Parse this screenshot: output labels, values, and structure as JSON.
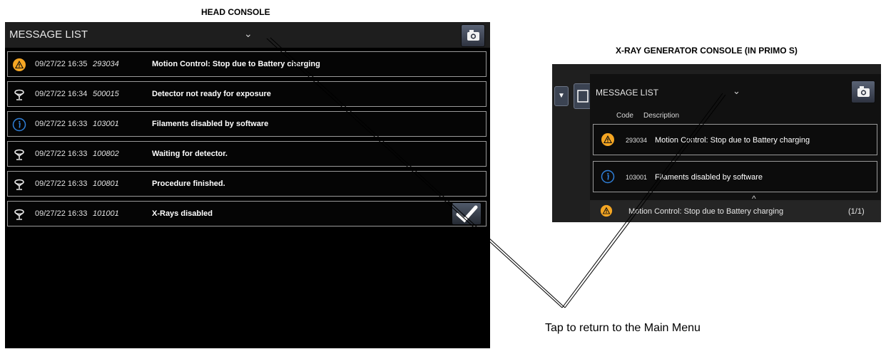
{
  "captions": {
    "head_console": "HEAD CONSOLE",
    "xray_console": "X-RAY GENERATOR CONSOLE (IN PRIMO S)",
    "tap_note": "Tap to return to the Main Menu"
  },
  "head_console": {
    "title": "MESSAGE LIST",
    "chevron": "⌄",
    "messages": [
      {
        "icon": "warning-icon",
        "datetime": "09/27/22 16:35",
        "code": "293034",
        "description": "Motion Control: Stop due to Battery charging"
      },
      {
        "icon": "detector-icon",
        "datetime": "09/27/22 16:34",
        "code": "500015",
        "description": "Detector not ready for exposure"
      },
      {
        "icon": "info-icon",
        "datetime": "09/27/22 16:33",
        "code": "103001",
        "description": "Filaments disabled by software"
      },
      {
        "icon": "detector-icon",
        "datetime": "09/27/22 16:33",
        "code": "100802",
        "description": "Waiting for detector."
      },
      {
        "icon": "detector-icon",
        "datetime": "09/27/22 16:33",
        "code": "100801",
        "description": "Procedure finished."
      },
      {
        "icon": "detector-icon",
        "datetime": "09/27/22 16:33",
        "code": "101001",
        "description": "X-Rays disabled"
      }
    ]
  },
  "xray_console": {
    "title": "MESSAGE LIST",
    "chevron": "⌄",
    "dropdown_glyph": "▼",
    "col_code": "Code",
    "col_description": "Description",
    "messages": [
      {
        "icon": "warning-icon",
        "code": "293034",
        "description": "Motion Control: Stop due to Battery charging"
      },
      {
        "icon": "info-icon",
        "code": "103001",
        "description": "Filaments disabled by software"
      }
    ],
    "status": {
      "caret": "^",
      "message": "Motion Control: Stop due to Battery charging",
      "count": "(1/1)"
    }
  },
  "colors": {
    "warning": "#f5a623",
    "info": "#2f7fd8",
    "panel_bg": "#000000"
  }
}
